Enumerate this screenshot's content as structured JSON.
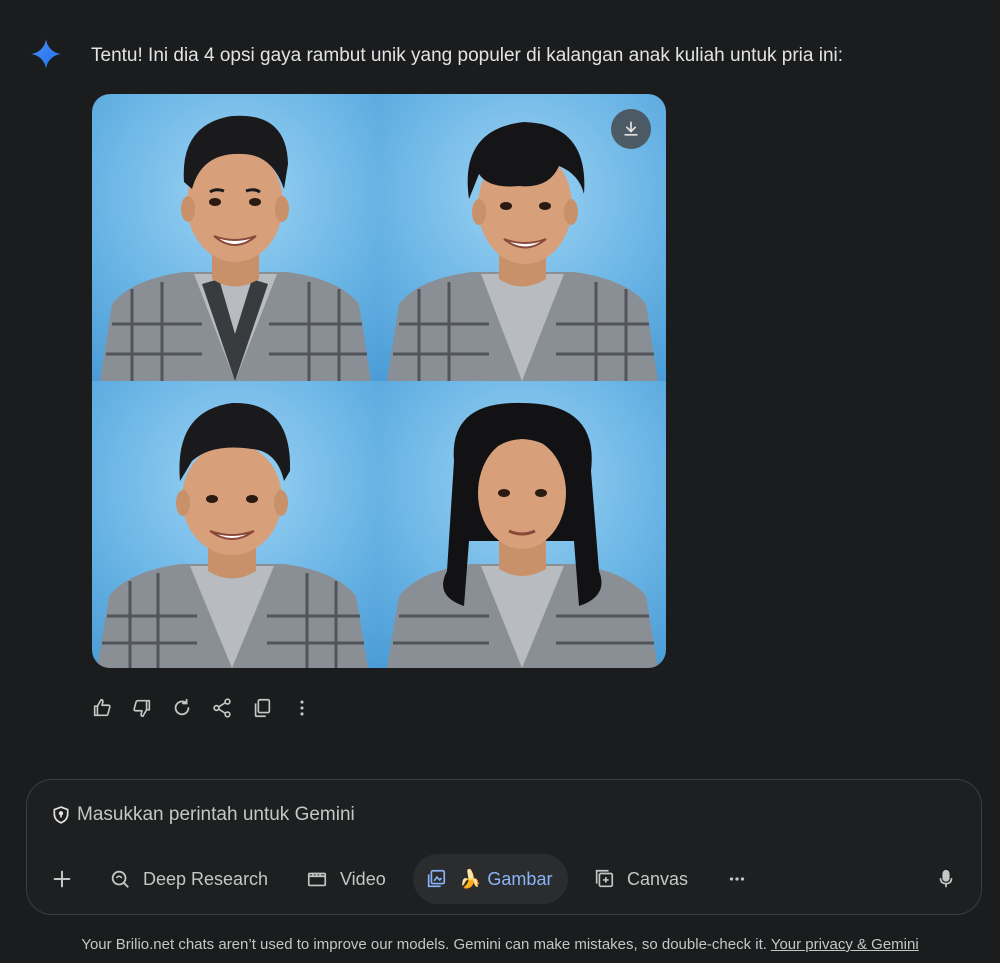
{
  "response": {
    "avatar_icon": "gemini-sparkle-icon",
    "avatar_color": "#4285f4",
    "text": "Tentu! Ini dia 4 opsi gaya rambut unik yang populer di kalangan anak kuliah untuk pria ini:",
    "images": [
      {
        "hair": "quiff"
      },
      {
        "hair": "fringe"
      },
      {
        "hair": "pompadour"
      },
      {
        "hair": "long"
      }
    ],
    "download_icon": "download-icon"
  },
  "actions": [
    {
      "icon": "thumbs-up-icon"
    },
    {
      "icon": "thumbs-down-icon"
    },
    {
      "icon": "regenerate-icon"
    },
    {
      "icon": "share-icon"
    },
    {
      "icon": "copy-icon"
    },
    {
      "icon": "more-vert-icon"
    }
  ],
  "composer": {
    "placeholder": "Masukkan perintah untuk Gemini",
    "tools": {
      "add_icon": "plus-icon",
      "deep_research": "Deep Research",
      "video": "Video",
      "gambar": "Gambar",
      "canvas": "Canvas",
      "more_icon": "more-horiz-icon",
      "mic_icon": "mic-icon"
    },
    "active_tool_color": "#8ab4f8"
  },
  "footer": {
    "text": "Your Brilio.net chats aren’t used to improve our models. Gemini can make mistakes, so double-check it. ",
    "link": "Your privacy & Gemini"
  }
}
